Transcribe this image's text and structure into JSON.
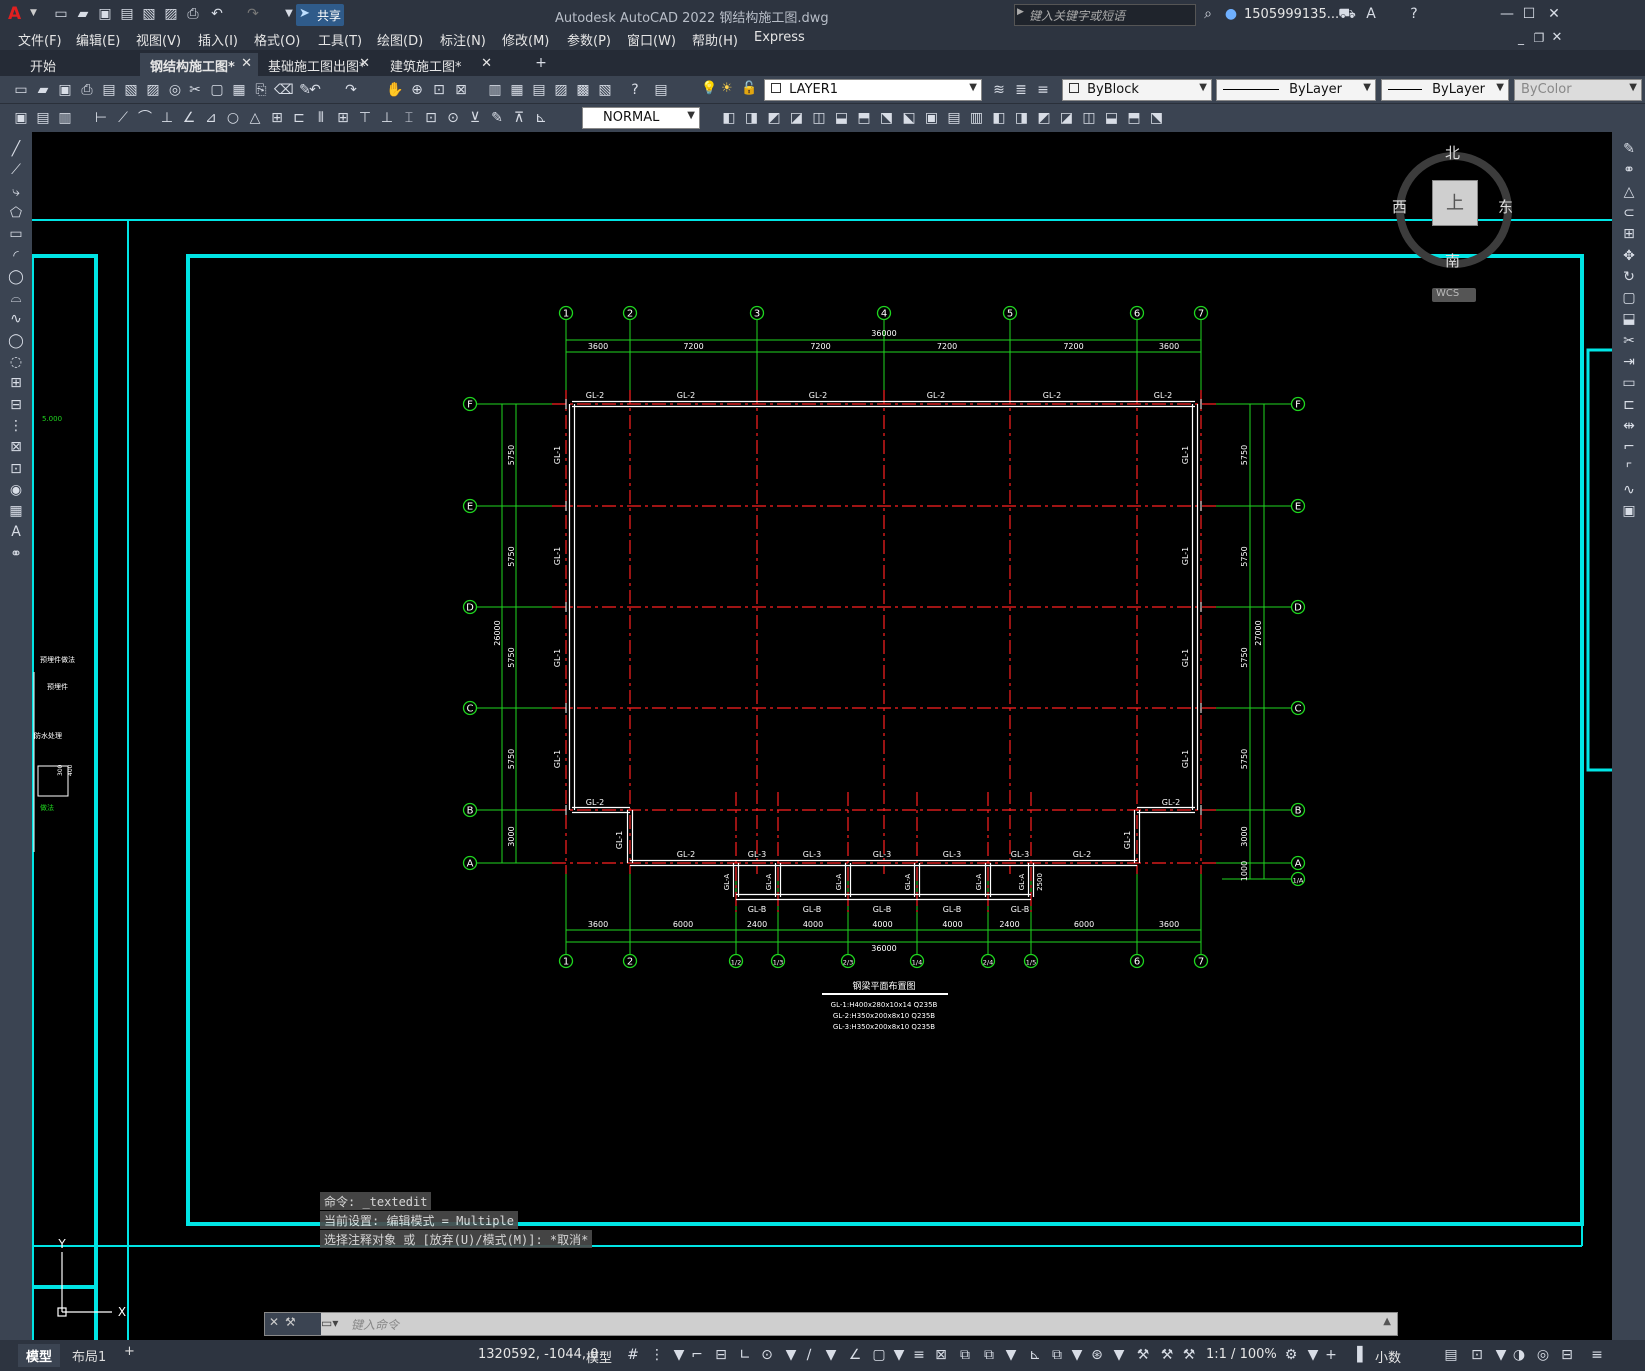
{
  "window": {
    "title": "Autodesk AutoCAD 2022    钢结构施工图.dwg",
    "share_label": "共享",
    "search_placeholder": "键入关键字或短语",
    "user": "1505999135...",
    "app_letter": "A"
  },
  "menu": [
    "文件(F)",
    "编辑(E)",
    "视图(V)",
    "插入(I)",
    "格式(O)",
    "工具(T)",
    "绘图(D)",
    "标注(N)",
    "修改(M)",
    "参数(P)",
    "窗口(W)",
    "帮助(H)",
    "Express"
  ],
  "tabs": [
    {
      "label": "开始",
      "active": false
    },
    {
      "label": "钢结构施工图*",
      "active": true
    },
    {
      "label": "基础施工图出图*",
      "active": false
    },
    {
      "label": "建筑施工图*",
      "active": false
    }
  ],
  "properties": {
    "layer": "LAYER1",
    "color": "ByBlock",
    "linetype": "ByLayer",
    "lineweight": "ByLayer",
    "plotstyle": "ByColor",
    "textstyle": "NORMAL"
  },
  "viewcube": {
    "north": "北",
    "south": "南",
    "east": "东",
    "west": "西",
    "top": "上",
    "wcs": "WCS"
  },
  "command": {
    "history": [
      "命令: _textedit",
      "当前设置: 编辑模式 = Multiple",
      "选择注释对象 或 [放弃(U)/模式(M)]: *取消*"
    ],
    "placeholder": "键入命令"
  },
  "drawing": {
    "grid_top": [
      "1",
      "2",
      "3",
      "4",
      "5",
      "6",
      "7"
    ],
    "grid_bottom": [
      "1",
      "2",
      "1/2",
      "1/3",
      "2/3",
      "1/4",
      "2/4",
      "1/5",
      "6",
      "7"
    ],
    "grid_rows": [
      "F",
      "E",
      "D",
      "C",
      "B",
      "A"
    ],
    "grid_extra_row": "1/A",
    "dims_top": [
      "3600",
      "7200",
      "7200",
      "7200",
      "7200",
      "3600"
    ],
    "dim_top_total": "36000",
    "dims_bottom": [
      "3600",
      "6000",
      "2400",
      "4000",
      "4000",
      "4000",
      "2400",
      "6000",
      "3600"
    ],
    "dim_bottom_total": "36000",
    "dims_left": [
      "5750",
      "5750",
      "5750",
      "5750",
      "3000"
    ],
    "dim_left_total": "26000",
    "dims_right": [
      "5750",
      "5750",
      "5750",
      "5750",
      "3000",
      "1000"
    ],
    "dim_right_total": "27000",
    "dim_small": "2500",
    "beam_top": [
      "GL-2",
      "GL-2",
      "GL-2",
      "GL-2",
      "GL-2",
      "GL-2"
    ],
    "beam_left": [
      "GL-1",
      "GL-1",
      "GL-1",
      "GL-1"
    ],
    "beam_right": [
      "GL-1",
      "GL-1",
      "GL-1",
      "GL-1"
    ],
    "beam_b_left": "GL-2",
    "beam_b_right": "GL-2",
    "beam_notch_left": "GL-1",
    "beam_notch_right": "GL-1",
    "beam_a": [
      "GL-2",
      "GL-3",
      "GL-3",
      "GL-3",
      "GL-3",
      "GL-3",
      "GL-2"
    ],
    "beam_ga": [
      "GL-A",
      "GL-A",
      "GL-A",
      "GL-A",
      "GL-A",
      "GL-A"
    ],
    "beam_gb": [
      "GL-B",
      "GL-B",
      "GL-B",
      "GL-B",
      "GL-B"
    ],
    "legend_title": "钢梁平面布置图",
    "legend_lines": [
      "GL-1:H400x280x10x14 Q235B",
      "GL-2:H350x200x8x10 Q235B",
      "GL-3:H350x200x8x10 Q235B"
    ],
    "side_texts": [
      "5.000",
      "预埋件做法",
      "预埋件",
      "防水处理",
      "300",
      "400",
      "做法"
    ]
  },
  "status": {
    "layout_tabs": [
      "模型",
      "布局1"
    ],
    "coords": "1320592, -1044, 0",
    "space": "模型",
    "scale": "1:1 / 100%",
    "units": "小数"
  },
  "colors": {
    "accent": "#00e5e5",
    "grid": "#1fd61f",
    "beam": "#ffffff",
    "axis": "#ff2020"
  }
}
